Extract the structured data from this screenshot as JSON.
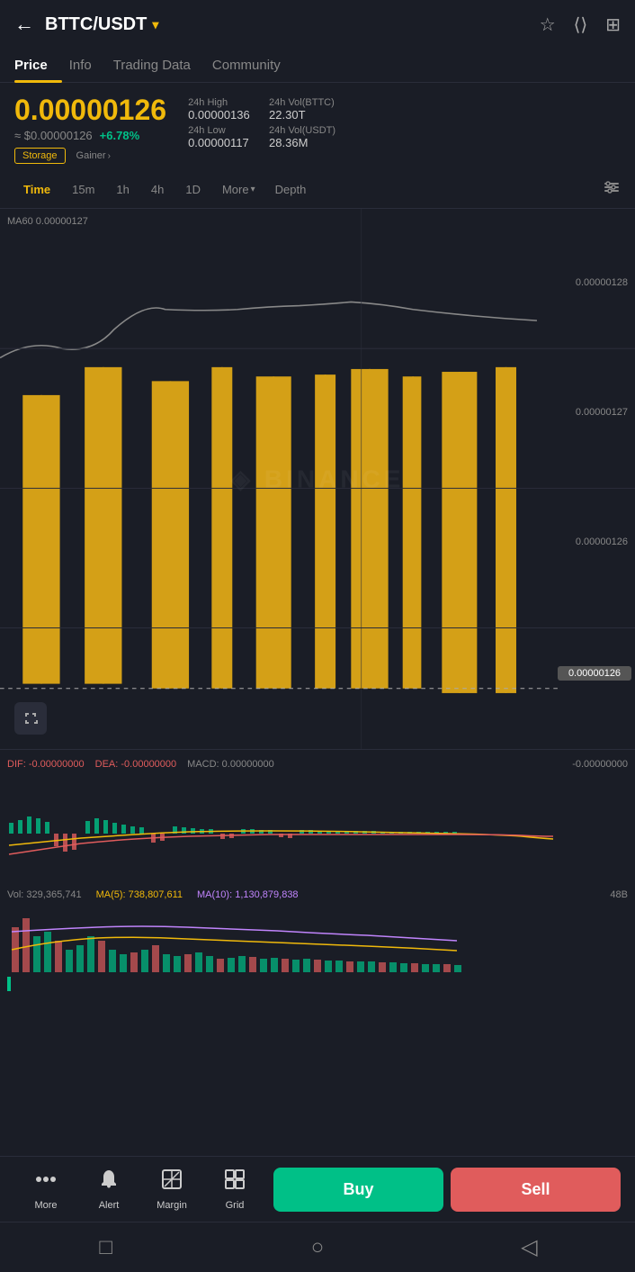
{
  "header": {
    "pair": "BTTC/USDT",
    "back_label": "←",
    "dropdown_icon": "▾"
  },
  "tabs": [
    {
      "id": "price",
      "label": "Price",
      "active": true
    },
    {
      "id": "info",
      "label": "Info",
      "active": false
    },
    {
      "id": "trading-data",
      "label": "Trading Data",
      "active": false
    },
    {
      "id": "community",
      "label": "Community",
      "active": false
    }
  ],
  "price": {
    "main": "0.00000126",
    "usd": "≈ $0.00000126",
    "change": "+6.78%",
    "tag_storage": "Storage",
    "tag_gainer": "Gainer"
  },
  "stats": {
    "high_label": "24h High",
    "high_value": "0.00000136",
    "vol_bttc_label": "24h Vol(BTTC)",
    "vol_bttc_value": "22.30T",
    "low_label": "24h Low",
    "low_value": "0.00000117",
    "vol_usdt_label": "24h Vol(USDT)",
    "vol_usdt_value": "28.36M"
  },
  "chart_controls": {
    "time_label": "Time",
    "intervals": [
      "15m",
      "1h",
      "4h",
      "1D"
    ],
    "more_label": "More",
    "depth_label": "Depth",
    "active_interval": "Time"
  },
  "chart": {
    "ma60_label": "MA60 0.00000127",
    "price_levels": [
      "0.00000128",
      "0.00000127",
      "0.00000126"
    ],
    "current_price": "0.00000126",
    "watermark": "◈ BINANCE"
  },
  "macd": {
    "dif_label": "DIF:",
    "dif_value": "-0.00000000",
    "dea_label": "DEA:",
    "dea_value": "-0.00000000",
    "macd_label": "MACD:",
    "macd_value": "0.00000000",
    "right_value": "-0.00000000"
  },
  "volume": {
    "vol_label": "Vol:",
    "vol_value": "329,365,741",
    "ma5_label": "MA(5):",
    "ma5_value": "738,807,611",
    "ma10_label": "MA(10):",
    "ma10_value": "1,130,879,838",
    "right_value": "48B"
  },
  "bottom_bar": {
    "more_label": "More",
    "alert_label": "Alert",
    "margin_label": "Margin",
    "grid_label": "Grid",
    "buy_label": "Buy",
    "sell_label": "Sell"
  },
  "nav": {
    "square_icon": "□",
    "circle_icon": "○",
    "back_icon": "◁"
  }
}
